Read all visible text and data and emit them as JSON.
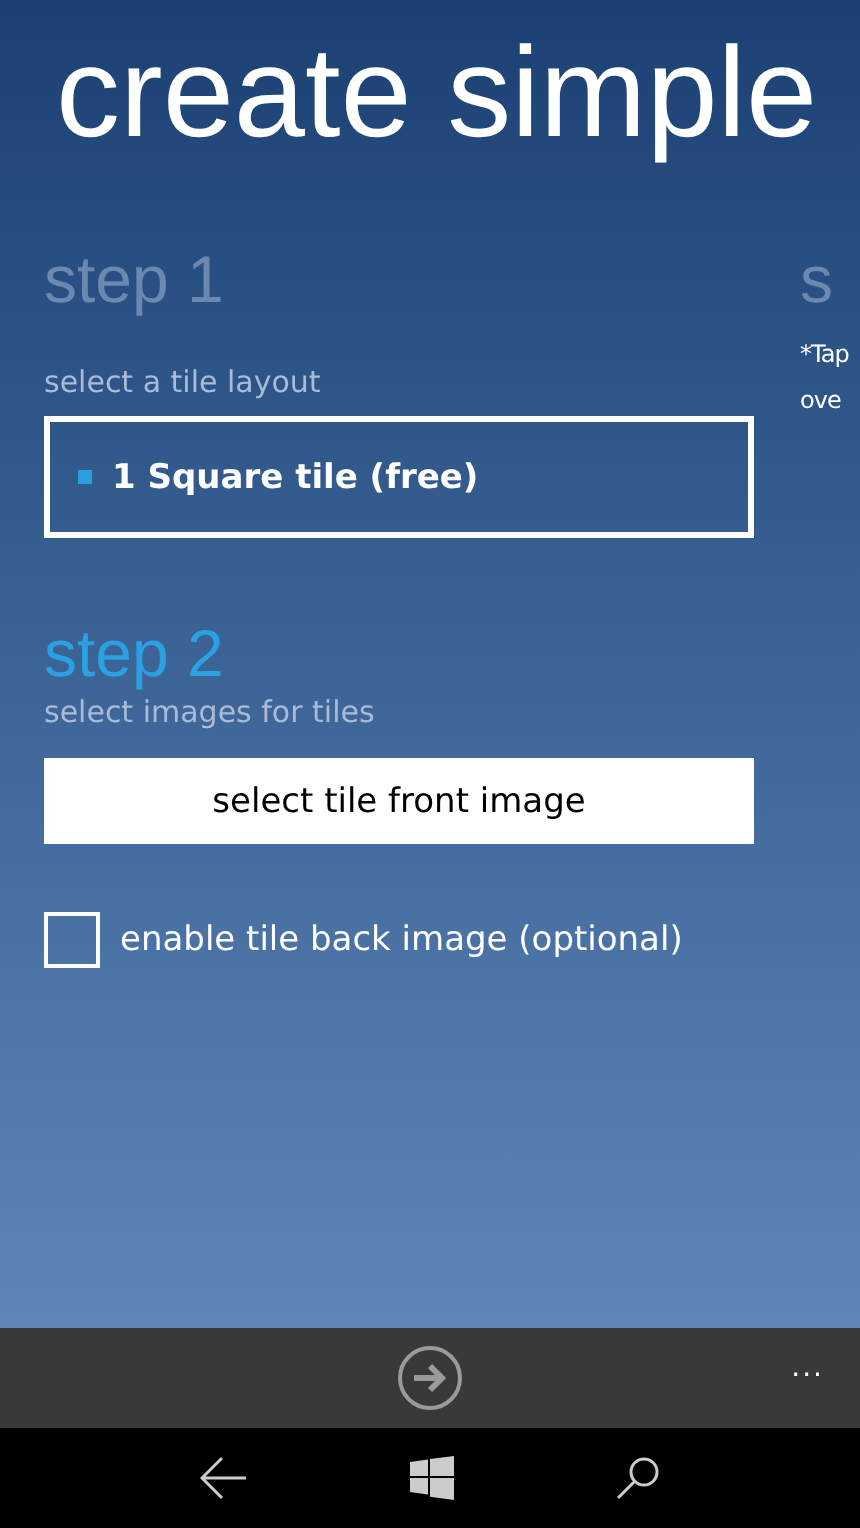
{
  "title": "create simple",
  "sections": [
    {
      "heading": "step 1",
      "active": false,
      "subtitle": "select a tile layout",
      "layouts": [
        {
          "label": "1 Square tile (free)",
          "selected": true
        }
      ]
    },
    {
      "heading": "step 2",
      "active": true,
      "subtitle": "select images for tiles",
      "button": "select tile front image",
      "checkbox": {
        "label": "enable tile back image (optional)",
        "checked": false
      }
    },
    {
      "heading": "s",
      "active": false,
      "note_lines": [
        "*Tap",
        "ove"
      ]
    }
  ],
  "app_bar": {
    "more": "..."
  }
}
